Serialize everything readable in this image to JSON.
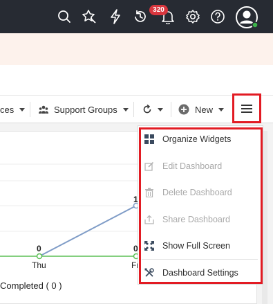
{
  "header": {
    "notification_count": "320",
    "icons": [
      "search-icon",
      "magic-wand-icon",
      "lightning-icon",
      "history-icon",
      "bell-icon",
      "gear-icon",
      "help-icon",
      "user-avatar-icon"
    ]
  },
  "toolbar": {
    "services_label": "ces",
    "support_groups_label": "Support Groups",
    "new_label": "New"
  },
  "chart_data": {
    "type": "line",
    "categories": [
      "Thu",
      "Fr"
    ],
    "point_labels": [
      "0",
      "0",
      "1"
    ],
    "legend": "Completed ( 0 )",
    "colors": {
      "series_line": "#7f9cc7",
      "zero_line": "#5bbf55"
    }
  },
  "menu": {
    "items": [
      {
        "label": "Organize Widgets",
        "icon": "grid-icon",
        "enabled": true
      },
      {
        "label": "Edit Dashboard",
        "icon": "edit-icon",
        "enabled": false
      },
      {
        "label": "Delete Dashboard",
        "icon": "trash-icon",
        "enabled": false
      },
      {
        "label": "Share Dashboard",
        "icon": "share-icon",
        "enabled": false
      },
      {
        "label": "Show Full Screen",
        "icon": "fullscreen-icon",
        "enabled": true
      },
      {
        "label": "Dashboard Settings",
        "icon": "settings-tools-icon",
        "enabled": true
      }
    ]
  },
  "colors": {
    "accent_red": "#e21b23",
    "topbar": "#272b33",
    "banner": "#fdf2ec"
  }
}
